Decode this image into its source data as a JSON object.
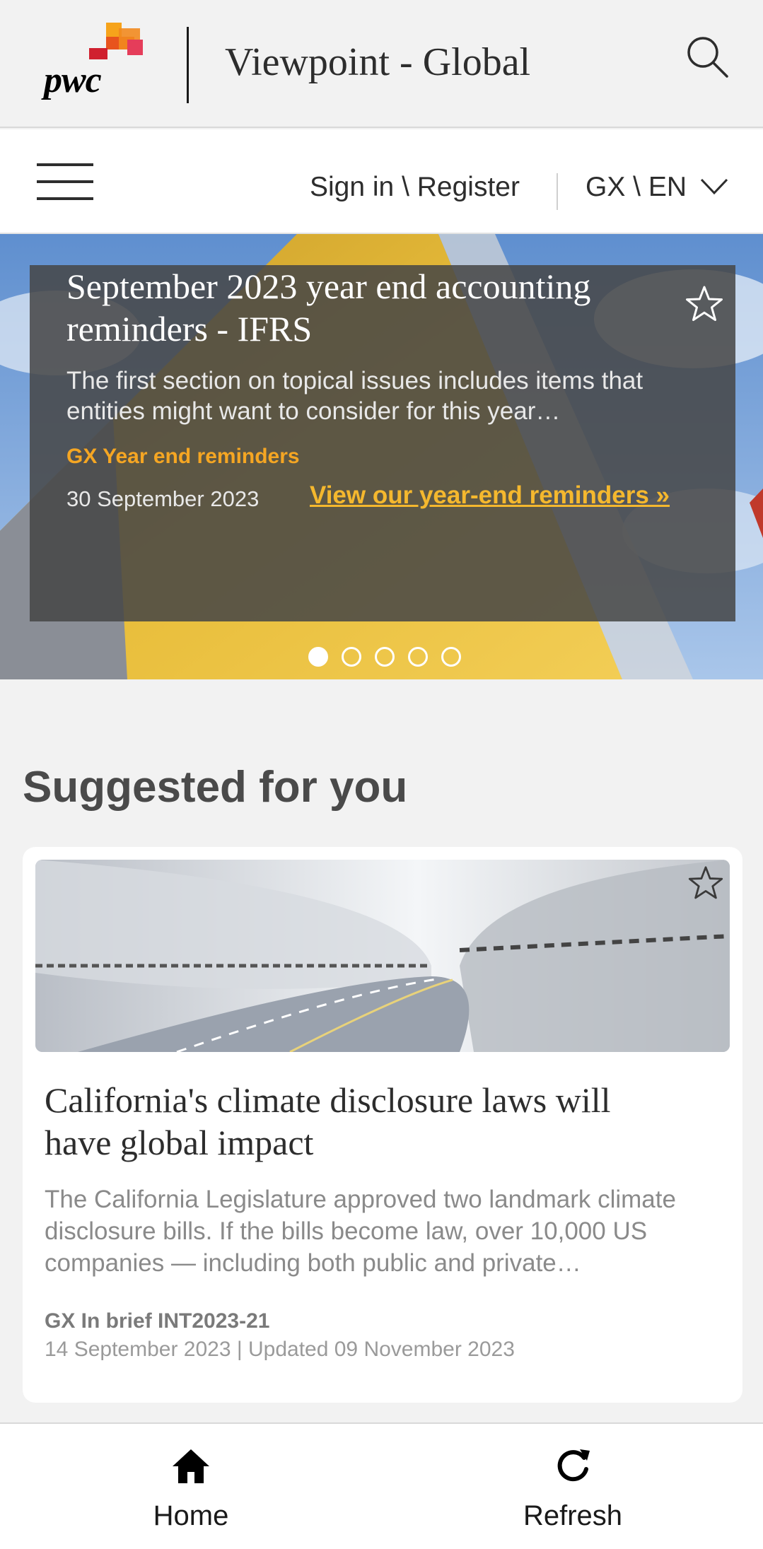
{
  "header": {
    "logo_text": "pwc",
    "title": "Viewpoint - Global",
    "search_icon": "search-icon"
  },
  "nav": {
    "menu_icon": "hamburger-icon",
    "signin_label": "Sign in \\ Register",
    "language_label": "GX \\ EN",
    "language_icon": "chevron-down-icon"
  },
  "hero": {
    "title": "September 2023 year end accounting reminders - IFRS",
    "description": "The first section on topical issues includes items that entities might want to consider for this year…",
    "tag": "GX Year end reminders",
    "date": "30 September 2023",
    "link_label": "View our year-end reminders »",
    "favorite_icon": "star-outline-icon",
    "slide_count": 5,
    "active_slide": 1
  },
  "suggested": {
    "heading": "Suggested for you",
    "cards": [
      {
        "title": "California's climate disclosure laws will have global impact",
        "description": "The California Legislature approved two landmark climate disclosure bills. If the bills become law, over 10,000 US companies — including both public and private…",
        "tag": "GX In brief INT2023-21",
        "date": "14 September 2023 | Updated 09 November 2023",
        "favorite_icon": "star-outline-icon"
      }
    ]
  },
  "tabbar": {
    "home_label": "Home",
    "home_icon": "home-icon",
    "refresh_label": "Refresh",
    "refresh_icon": "refresh-icon"
  },
  "colors": {
    "accent_orange": "#f5a623",
    "link_gold": "#f5b82e",
    "panel_overlay": "#464646"
  }
}
